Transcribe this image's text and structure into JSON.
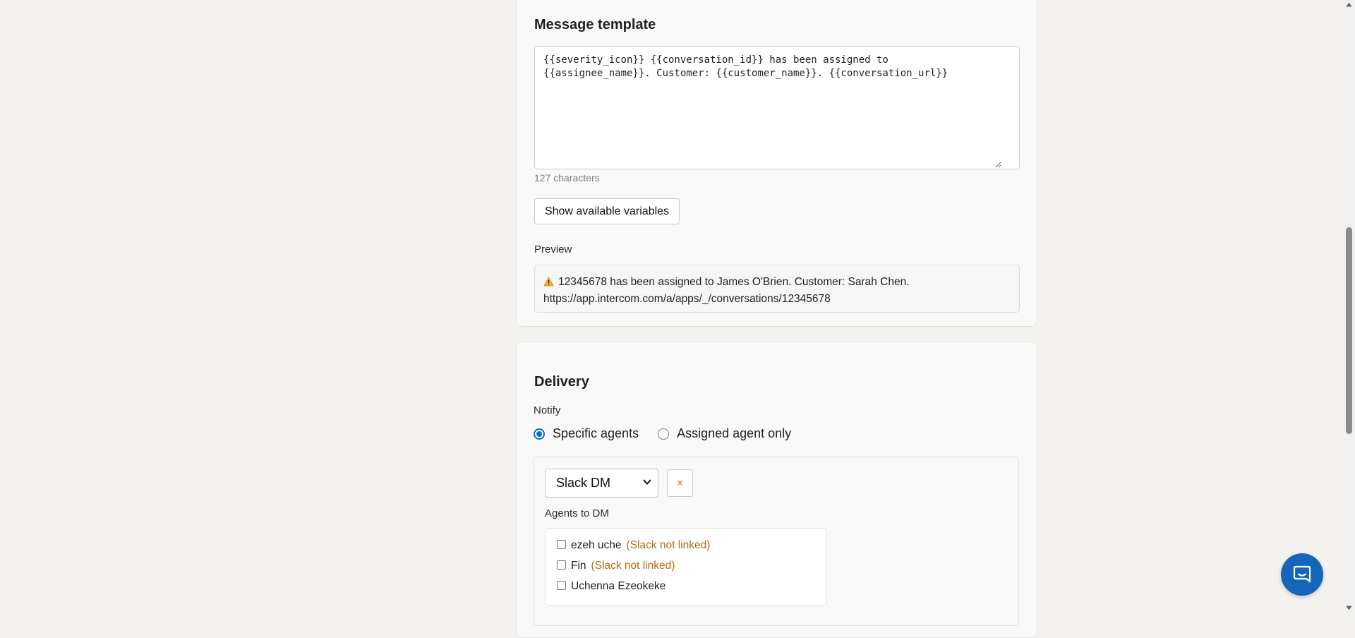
{
  "message_template": {
    "title": "Message template",
    "template_value": "{{severity_icon}} {{conversation_id}} has been assigned to\n{{assignee_name}}. Customer: {{customer_name}}. {{conversation_url}}",
    "char_count": "127 characters",
    "show_variables_label": "Show available variables",
    "preview_label": "Preview",
    "preview_line1": "12345678 has been assigned to James O'Brien. Customer: Sarah Chen.",
    "preview_line2": "https://app.intercom.com/a/apps/_/conversations/12345678"
  },
  "delivery": {
    "title": "Delivery",
    "notify_label": "Notify",
    "options": [
      {
        "label": "Specific agents",
        "selected": true
      },
      {
        "label": "Assigned agent only",
        "selected": false
      }
    ],
    "channel_selected": "Slack DM",
    "remove_label": "×",
    "agents_label": "Agents to DM",
    "agents": [
      {
        "name": "ezeh uche",
        "note": "(Slack not linked)",
        "checked": false
      },
      {
        "name": "Fin",
        "note": "(Slack not linked)",
        "checked": false
      },
      {
        "name": "Uchenna Ezeokeke",
        "note": "",
        "checked": false
      }
    ]
  },
  "colors": {
    "accent": "#0b6bcb",
    "warning_note": "#b36b12",
    "launcher": "#1565b8"
  }
}
